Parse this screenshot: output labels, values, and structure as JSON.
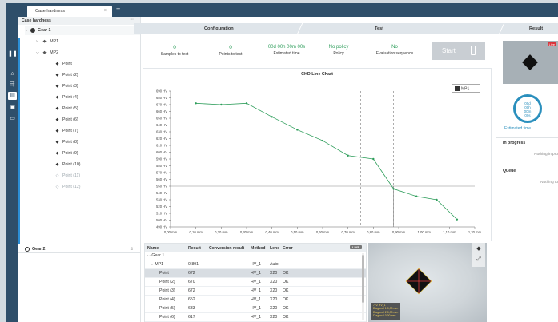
{
  "app": {
    "doc_tab": "Case hardness",
    "close_glyph": "×",
    "add_glyph": "+"
  },
  "tree": {
    "header": "Case hardness",
    "menu_glyph": "···",
    "gear1": "Gear 1",
    "mp1": "MP1",
    "mp2": "MP2",
    "points": [
      "Point",
      "Point (2)",
      "Point (3)",
      "Point (4)",
      "Point (5)",
      "Point (6)",
      "Point (7)",
      "Point (8)",
      "Point (9)",
      "Point (10)",
      "Point (11)",
      "Point (12)"
    ],
    "gear2": "Gear 2",
    "sort_glyph": "⇕"
  },
  "steps": {
    "configuration": "Configuration",
    "test": "Test",
    "result": "Result"
  },
  "stats": {
    "samples_value": "0",
    "samples_label": "Samples to test",
    "points_value": "0",
    "points_label": "Points to test",
    "time_value": "00d 00h 00m 00s",
    "time_label": "Estimated time",
    "policy_value": "No policy",
    "policy_label": "Policy",
    "eval_value": "No",
    "eval_label": "Evaluation sequence",
    "start_label": "Start"
  },
  "chart_data": {
    "type": "line",
    "title": "CHD Line Chart",
    "xlabel": "",
    "ylabel": "",
    "x_ticks": [
      "0,00 mm",
      "0,10 mm",
      "0,20 mm",
      "0,30 mm",
      "0,40 mm",
      "0,50 mm",
      "0,60 mm",
      "0,70 mm",
      "0,80 mm",
      "0,90 mm",
      "1,00 mm",
      "1,10 mm",
      "1,20 mm"
    ],
    "y_ticks": [
      "490 HV",
      "500 HV",
      "510 HV",
      "520 HV",
      "530 HV",
      "540 HV",
      "550 HV",
      "560 HV",
      "570 HV",
      "580 HV",
      "590 HV",
      "600 HV",
      "610 HV",
      "620 HV",
      "630 HV",
      "640 HV",
      "650 HV",
      "660 HV",
      "670 HV",
      "680 HV",
      "690 HV"
    ],
    "xlim": [
      0,
      1.2
    ],
    "ylim": [
      490,
      690
    ],
    "series": [
      {
        "name": "MP1",
        "x": [
          0.1,
          0.2,
          0.3,
          0.4,
          0.5,
          0.6,
          0.7,
          0.8,
          0.88,
          0.97,
          1.05,
          1.13
        ],
        "y": [
          672,
          670,
          672,
          652,
          633,
          617,
          595,
          590,
          546,
          535,
          530,
          501
        ]
      }
    ],
    "threshold_hv": 550,
    "vlines_mm": [
      0.75,
      0.88,
      1.0
    ],
    "threshold_x_mm": 0.88,
    "color": "#2d9d5a",
    "legend_label": "MP1"
  },
  "table": {
    "columns": [
      "Name",
      "Result",
      "Conversion result",
      "Method",
      "Lens",
      "Error"
    ],
    "live_label": "LIVE",
    "rows": [
      {
        "name": "Gear 1",
        "result": "",
        "conv": "",
        "method": "",
        "lens": "",
        "error": "",
        "indent": 1,
        "chev": "⌵"
      },
      {
        "name": "MP1",
        "result": "0.891",
        "conv": "",
        "method": "HV_1",
        "lens": "Auto",
        "error": "",
        "indent": 2,
        "chev": "⌵"
      },
      {
        "name": "Point",
        "result": "672",
        "conv": "",
        "method": "HV_1",
        "lens": "X20",
        "error": "OK",
        "indent": 3,
        "chev": ""
      },
      {
        "name": "Point (2)",
        "result": "670",
        "conv": "",
        "method": "HV_1",
        "lens": "X20",
        "error": "OK",
        "indent": 3,
        "chev": ""
      },
      {
        "name": "Point (3)",
        "result": "672",
        "conv": "",
        "method": "HV_1",
        "lens": "X20",
        "error": "OK",
        "indent": 3,
        "chev": ""
      },
      {
        "name": "Point (4)",
        "result": "652",
        "conv": "",
        "method": "HV_1",
        "lens": "X20",
        "error": "OK",
        "indent": 3,
        "chev": ""
      },
      {
        "name": "Point (5)",
        "result": "633",
        "conv": "",
        "method": "HV_1",
        "lens": "X20",
        "error": "OK",
        "indent": 3,
        "chev": ""
      },
      {
        "name": "Point (6)",
        "result": "617",
        "conv": "",
        "method": "HV_1",
        "lens": "X20",
        "error": "OK",
        "indent": 3,
        "chev": ""
      }
    ]
  },
  "micro": {
    "info_lines": [
      "772 HV_1",
      "Diagonal 1 0,00 mm",
      "Diagonal 2 0,00 mm",
      "Diagonal 0,00 mm"
    ],
    "live_label": "Live"
  },
  "right": {
    "ring_lines": [
      "00d",
      "00h",
      "00m",
      "00s"
    ],
    "estimated_time": "Estimated time",
    "in_progress": "In progress",
    "in_progress_note": "Nothing in pro",
    "queue": "Queue",
    "queue_note": "Nothing to"
  }
}
